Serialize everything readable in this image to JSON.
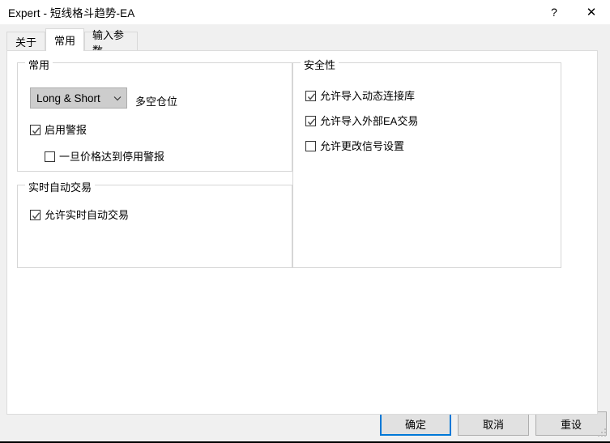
{
  "window": {
    "title": "Expert - 短线格斗趋势-EA",
    "help_label": "?",
    "close_label": "✕"
  },
  "tabs": [
    {
      "label": "关于",
      "active": false
    },
    {
      "label": "常用",
      "active": true
    },
    {
      "label": "输入参数",
      "active": false
    }
  ],
  "groups": {
    "common": {
      "legend": "常用",
      "combo": {
        "value": "Long & Short",
        "side_label": "多空仓位"
      },
      "checks": [
        {
          "label": "启用警报",
          "checked": true
        },
        {
          "label": "一旦价格达到停用警报",
          "checked": false
        }
      ]
    },
    "live_trading": {
      "legend": "实时自动交易",
      "checks": [
        {
          "label": "允许实时自动交易",
          "checked": true
        }
      ]
    },
    "security": {
      "legend": "安全性",
      "checks": [
        {
          "label": "允许导入动态连接库",
          "checked": true
        },
        {
          "label": "允许导入外部EA交易",
          "checked": true
        },
        {
          "label": "允许更改信号设置",
          "checked": false
        }
      ]
    }
  },
  "footer": {
    "ok_label": "确定",
    "cancel_label": "取消",
    "reset_label": "重设"
  },
  "colors": {
    "accent": "#0078d7",
    "dialog_bg": "#f0f0f0",
    "panel_bg": "#ffffff",
    "button_bg": "#e1e1e1",
    "combo_bg": "#cdcdcd"
  }
}
